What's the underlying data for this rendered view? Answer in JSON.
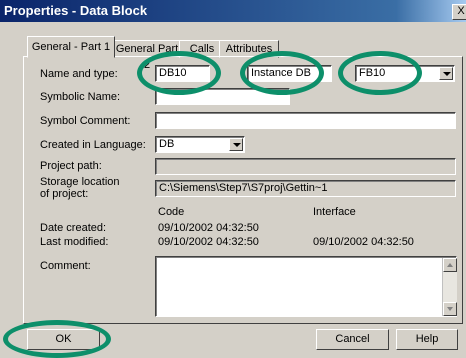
{
  "window": {
    "title": "Properties - Data Block",
    "close_symbol": "X"
  },
  "tabs": [
    {
      "label": "General - Part 1",
      "active": true
    },
    {
      "label": "General Part 2",
      "active": false
    },
    {
      "label": "Calls",
      "active": false
    },
    {
      "label": "Attributes",
      "active": false
    }
  ],
  "form": {
    "name_type_label": "Name and type:",
    "name_value": "DB10",
    "type_value": "Instance DB",
    "fb_value": "FB10",
    "symbolic_name_label": "Symbolic Name:",
    "symbolic_name_value": "",
    "symbol_comment_label": "Symbol Comment:",
    "symbol_comment_value": "",
    "created_language_label": "Created in Language:",
    "created_language_value": "DB",
    "project_path_label": "Project path:",
    "project_path_value": "",
    "storage_label_line1": "Storage location",
    "storage_label_line2": "of project:",
    "storage_value": "C:\\Siemens\\Step7\\S7proj\\Gettin~1",
    "code_header": "Code",
    "interface_header": "Interface",
    "date_created_label": "Date created:",
    "date_created_code": "09/10/2002  04:32:50",
    "last_modified_label": "Last modified:",
    "last_modified_code": "09/10/2002  04:32:50",
    "last_modified_interface": "09/10/2002  04:32:50",
    "comment_label": "Comment:",
    "comment_value": ""
  },
  "buttons": {
    "ok": "OK",
    "cancel": "Cancel",
    "help": "Help"
  },
  "annotation": {
    "highlight_color": "#0d8f6a"
  }
}
